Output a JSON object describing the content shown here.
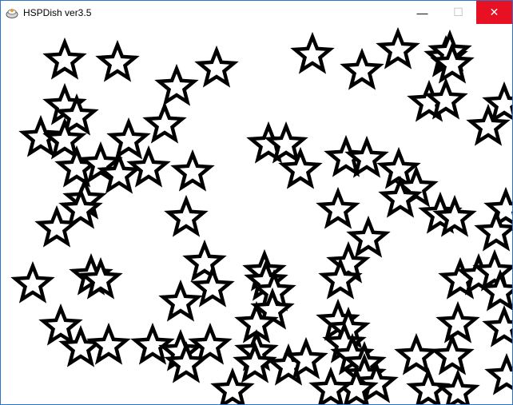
{
  "window": {
    "title": "HSPDish ver3.5",
    "icon": "hsp-dish-app-icon",
    "controls": {
      "minimize_glyph": "—",
      "maximize_glyph": "☐",
      "close_glyph": "✕"
    }
  },
  "canvas": {
    "background": "#ffffff",
    "star_fill": "#ffffff",
    "star_stroke": "#000000"
  }
}
